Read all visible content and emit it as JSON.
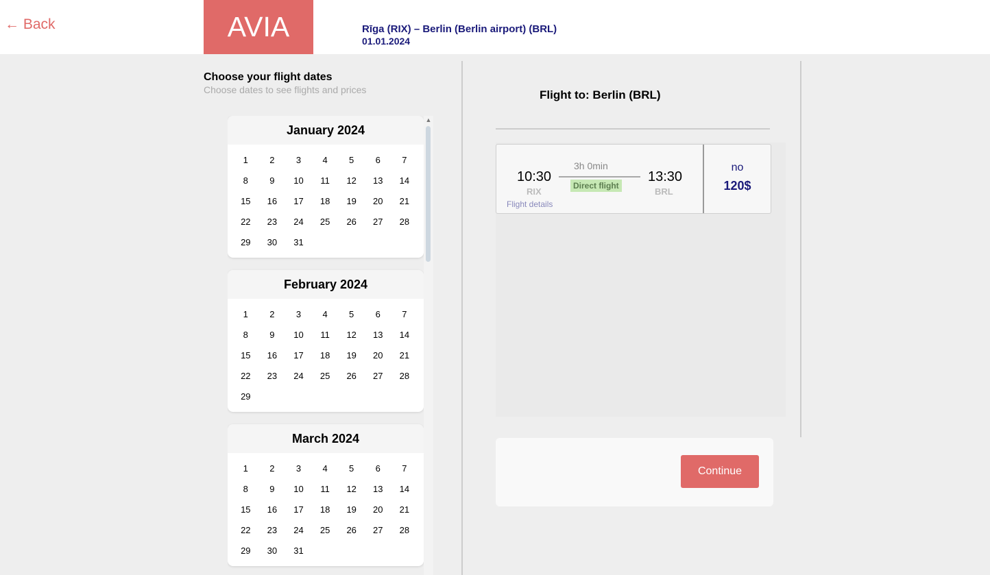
{
  "header": {
    "back_label": "← Back",
    "logo": "AVIA",
    "route": "Rīga (RIX) – Berlin (Berlin airport) (BRL)",
    "date": "01.01.2024"
  },
  "calendar": {
    "title": "Choose your flight dates",
    "subtitle": "Choose dates to see flights and prices",
    "months": [
      {
        "name": "January 2024",
        "days": 31
      },
      {
        "name": "February 2024",
        "days": 29
      },
      {
        "name": "March 2024",
        "days": 31
      }
    ]
  },
  "results": {
    "heading": "Flight to: Berlin (BRL)",
    "flights": [
      {
        "dep_time": "10:30",
        "dep_code": "RIX",
        "arr_time": "13:30",
        "arr_code": "BRL",
        "duration": "3h 0min",
        "stops": "Direct flight",
        "details_label": "Flight details",
        "baggage": "no",
        "price": "120$"
      }
    ]
  },
  "actions": {
    "continue_label": "Continue"
  },
  "colors": {
    "accent": "#e06a68",
    "navy": "#1a1a7a",
    "direct_bg": "#c6e8b4"
  }
}
